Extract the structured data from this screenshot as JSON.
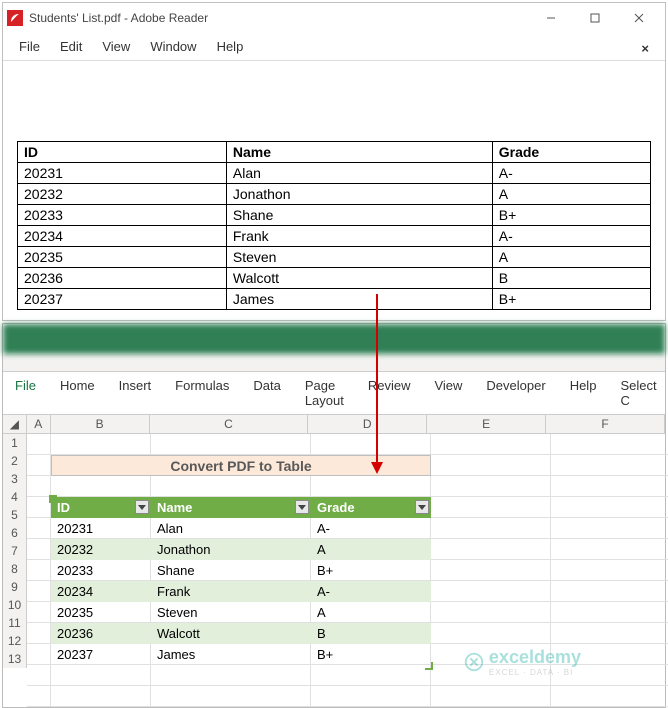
{
  "adobe": {
    "title": "Students' List.pdf - Adobe Reader",
    "menu": {
      "file": "File",
      "edit": "Edit",
      "view": "View",
      "window": "Window",
      "help": "Help"
    },
    "table": {
      "headers": {
        "id": "ID",
        "name": "Name",
        "grade": "Grade"
      },
      "rows": [
        {
          "id": "20231",
          "name": "Alan",
          "grade": "A-"
        },
        {
          "id": "20232",
          "name": "Jonathon",
          "grade": "A"
        },
        {
          "id": "20233",
          "name": "Shane",
          "grade": "B+"
        },
        {
          "id": "20234",
          "name": "Frank",
          "grade": "A-"
        },
        {
          "id": "20235",
          "name": "Steven",
          "grade": "A"
        },
        {
          "id": "20236",
          "name": "Walcott",
          "grade": "B"
        },
        {
          "id": "20237",
          "name": "James",
          "grade": "B+"
        }
      ]
    }
  },
  "excel": {
    "tabs": {
      "file": "File",
      "home": "Home",
      "insert": "Insert",
      "formulas": "Formulas",
      "data": "Data",
      "pagelayout": "Page Layout",
      "review": "Review",
      "view": "View",
      "developer": "Developer",
      "help": "Help",
      "select": "Select C"
    },
    "cols": {
      "A": "A",
      "B": "B",
      "C": "C",
      "D": "D",
      "E": "E",
      "F": "F"
    },
    "title": "Convert PDF to Table",
    "table": {
      "headers": {
        "id": "ID",
        "name": "Name",
        "grade": "Grade"
      },
      "rows": [
        {
          "id": "20231",
          "name": "Alan",
          "grade": "A-"
        },
        {
          "id": "20232",
          "name": "Jonathon",
          "grade": "A"
        },
        {
          "id": "20233",
          "name": "Shane",
          "grade": "B+"
        },
        {
          "id": "20234",
          "name": "Frank",
          "grade": "A-"
        },
        {
          "id": "20235",
          "name": "Steven",
          "grade": "A"
        },
        {
          "id": "20236",
          "name": "Walcott",
          "grade": "B"
        },
        {
          "id": "20237",
          "name": "James",
          "grade": "B+"
        }
      ]
    }
  },
  "watermark": {
    "brand": "exceldemy",
    "sub": "EXCEL · DATA · BI"
  }
}
